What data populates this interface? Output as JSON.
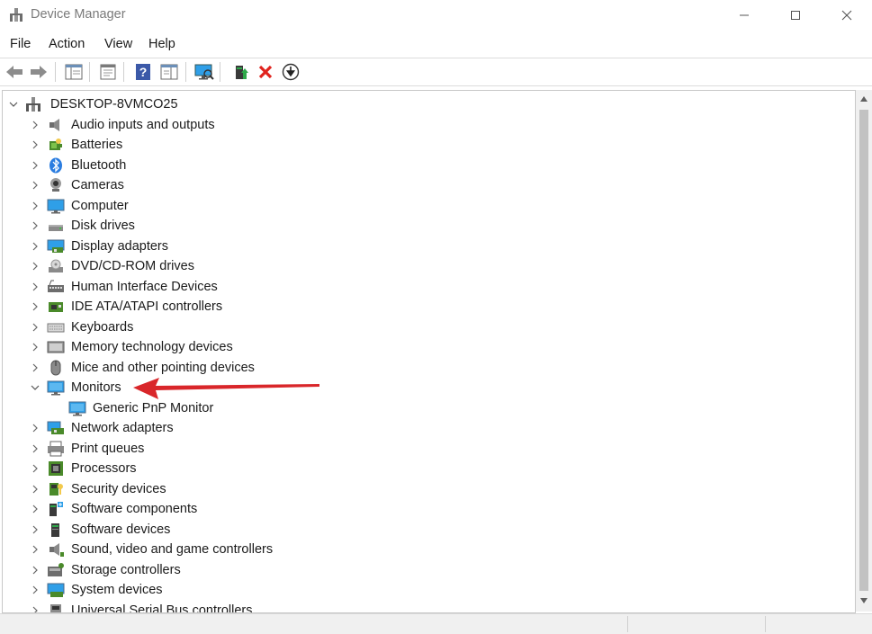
{
  "window": {
    "title": "Device Manager"
  },
  "menu": [
    "File",
    "Action",
    "View",
    "Help"
  ],
  "toolbar": [
    "back-icon",
    "forward-icon",
    "show-hide-console-tree-icon",
    "properties-icon",
    "help-icon",
    "view-icon",
    "scan-hardware-icon",
    "update-driver-icon",
    "uninstall-icon",
    "disable-device-icon"
  ],
  "tree": {
    "root": "DESKTOP-8VMCO25",
    "items": [
      {
        "label": "Audio inputs and outputs",
        "icon": "speaker-icon"
      },
      {
        "label": "Batteries",
        "icon": "battery-icon"
      },
      {
        "label": "Bluetooth",
        "icon": "bluetooth-icon"
      },
      {
        "label": "Cameras",
        "icon": "camera-icon"
      },
      {
        "label": "Computer",
        "icon": "computer-icon"
      },
      {
        "label": "Disk drives",
        "icon": "disk-drive-icon"
      },
      {
        "label": "Display adapters",
        "icon": "display-adapter-icon"
      },
      {
        "label": "DVD/CD-ROM drives",
        "icon": "dvd-drive-icon"
      },
      {
        "label": "Human Interface Devices",
        "icon": "hid-icon"
      },
      {
        "label": "IDE ATA/ATAPI controllers",
        "icon": "ide-controller-icon"
      },
      {
        "label": "Keyboards",
        "icon": "keyboard-icon"
      },
      {
        "label": "Memory technology devices",
        "icon": "memory-icon"
      },
      {
        "label": "Mice and other pointing devices",
        "icon": "mouse-icon"
      },
      {
        "label": "Monitors",
        "icon": "monitor-icon",
        "expanded": true
      },
      {
        "label": "Generic PnP Monitor",
        "icon": "monitor-icon",
        "child": true
      },
      {
        "label": "Network adapters",
        "icon": "network-icon"
      },
      {
        "label": "Print queues",
        "icon": "printer-icon"
      },
      {
        "label": "Processors",
        "icon": "processor-icon"
      },
      {
        "label": "Security devices",
        "icon": "security-icon"
      },
      {
        "label": "Software components",
        "icon": "software-component-icon"
      },
      {
        "label": "Software devices",
        "icon": "software-device-icon"
      },
      {
        "label": "Sound, video and game controllers",
        "icon": "sound-icon"
      },
      {
        "label": "Storage controllers",
        "icon": "storage-icon"
      },
      {
        "label": "System devices",
        "icon": "system-icon"
      },
      {
        "label": "Universal Serial Bus controllers",
        "icon": "usb-icon"
      }
    ]
  },
  "colors": {
    "annotation_arrow": "#d9262a",
    "monitor_blue": "#2f9fe8",
    "uninstall_red": "#e0231d"
  }
}
